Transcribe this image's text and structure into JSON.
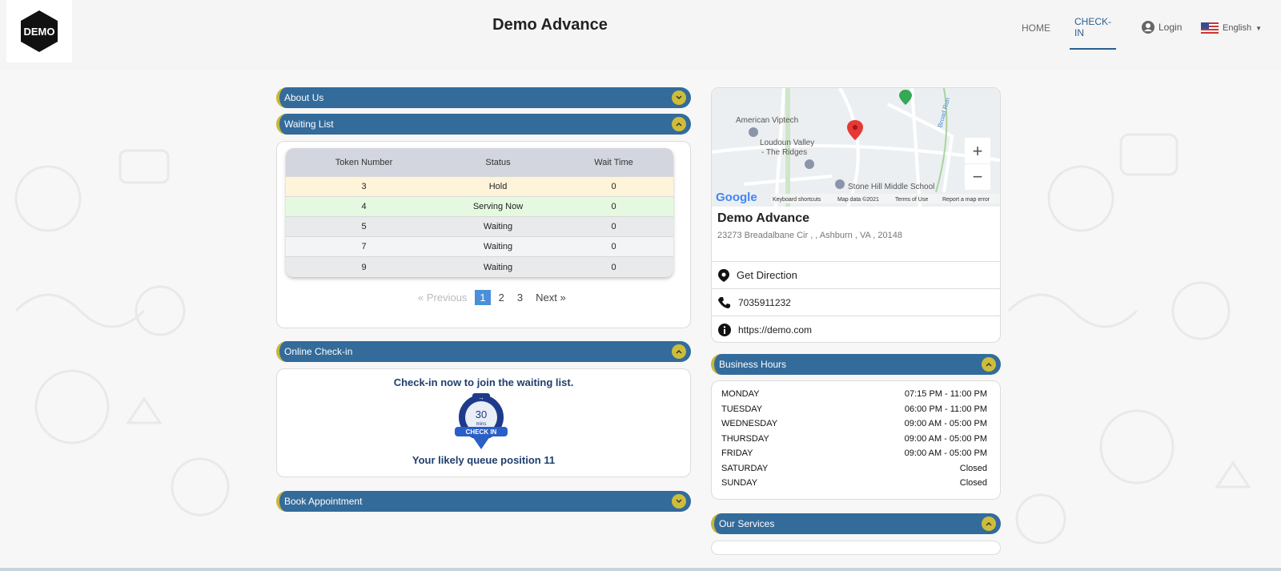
{
  "header": {
    "logo_text": "DEMO",
    "title": "Demo Advance",
    "nav": {
      "home": "HOME",
      "checkin": "CHECK-IN",
      "login": "Login",
      "language": "English"
    }
  },
  "left": {
    "about_label": "About Us",
    "waiting_label": "Waiting List",
    "table": {
      "headers": [
        "Token Number",
        "Status",
        "Wait Time"
      ],
      "rows": [
        {
          "token": "3",
          "status": "Hold",
          "wait": "0"
        },
        {
          "token": "4",
          "status": "Serving Now",
          "wait": "0"
        },
        {
          "token": "5",
          "status": "Waiting",
          "wait": "0"
        },
        {
          "token": "7",
          "status": "Waiting",
          "wait": "0"
        },
        {
          "token": "9",
          "status": "Waiting",
          "wait": "0"
        }
      ]
    },
    "pager": {
      "prev": "« Previous",
      "pages": [
        "1",
        "2",
        "3"
      ],
      "next": "Next »"
    },
    "checkin_label": "Online Check-in",
    "checkin": {
      "headline": "Check-in now to join the waiting list.",
      "badge_number": "30",
      "badge_unit": "mins",
      "badge_label": "CHECK IN",
      "queue_text": "Your likely queue position 11"
    },
    "appointment_label": "Book Appointment"
  },
  "right": {
    "map": {
      "labels": [
        "American Viptech",
        "Loudoun Valley",
        "- The Ridges",
        "Stone Hill Middle School",
        "Broad Run"
      ],
      "footer": [
        "Keyboard shortcuts",
        "Map data ©2021",
        "Terms of Use",
        "Report a map error"
      ],
      "google": "Google",
      "zoom_in": "+",
      "zoom_out": "−"
    },
    "business_name": "Demo Advance",
    "address": "23273 Breadalbane Cir , , Ashburn , VA , 20148",
    "direction": "Get Direction",
    "phone": "7035911232",
    "website": "https://demo.com",
    "hours_label": "Business Hours",
    "hours": [
      {
        "day": "MONDAY",
        "time": "07:15 PM - 11:00 PM"
      },
      {
        "day": "TUESDAY",
        "time": "06:00 PM - 11:00 PM"
      },
      {
        "day": "WEDNESDAY",
        "time": "09:00 AM - 05:00 PM"
      },
      {
        "day": "THURSDAY",
        "time": "09:00 AM - 05:00 PM"
      },
      {
        "day": "FRIDAY",
        "time": "09:00 AM - 05:00 PM"
      },
      {
        "day": "SATURDAY",
        "time": "Closed"
      },
      {
        "day": "SUNDAY",
        "time": "Closed"
      }
    ],
    "services_label": "Our Services"
  },
  "colors": {
    "bar_blue": "#336b9b",
    "accent_yellow": "#cdbd3a",
    "active_nav": "#2c5f8d",
    "hold_row": "#fdf4d9",
    "serving_row": "#e5f9e0",
    "page_active": "#4a8fd8"
  }
}
